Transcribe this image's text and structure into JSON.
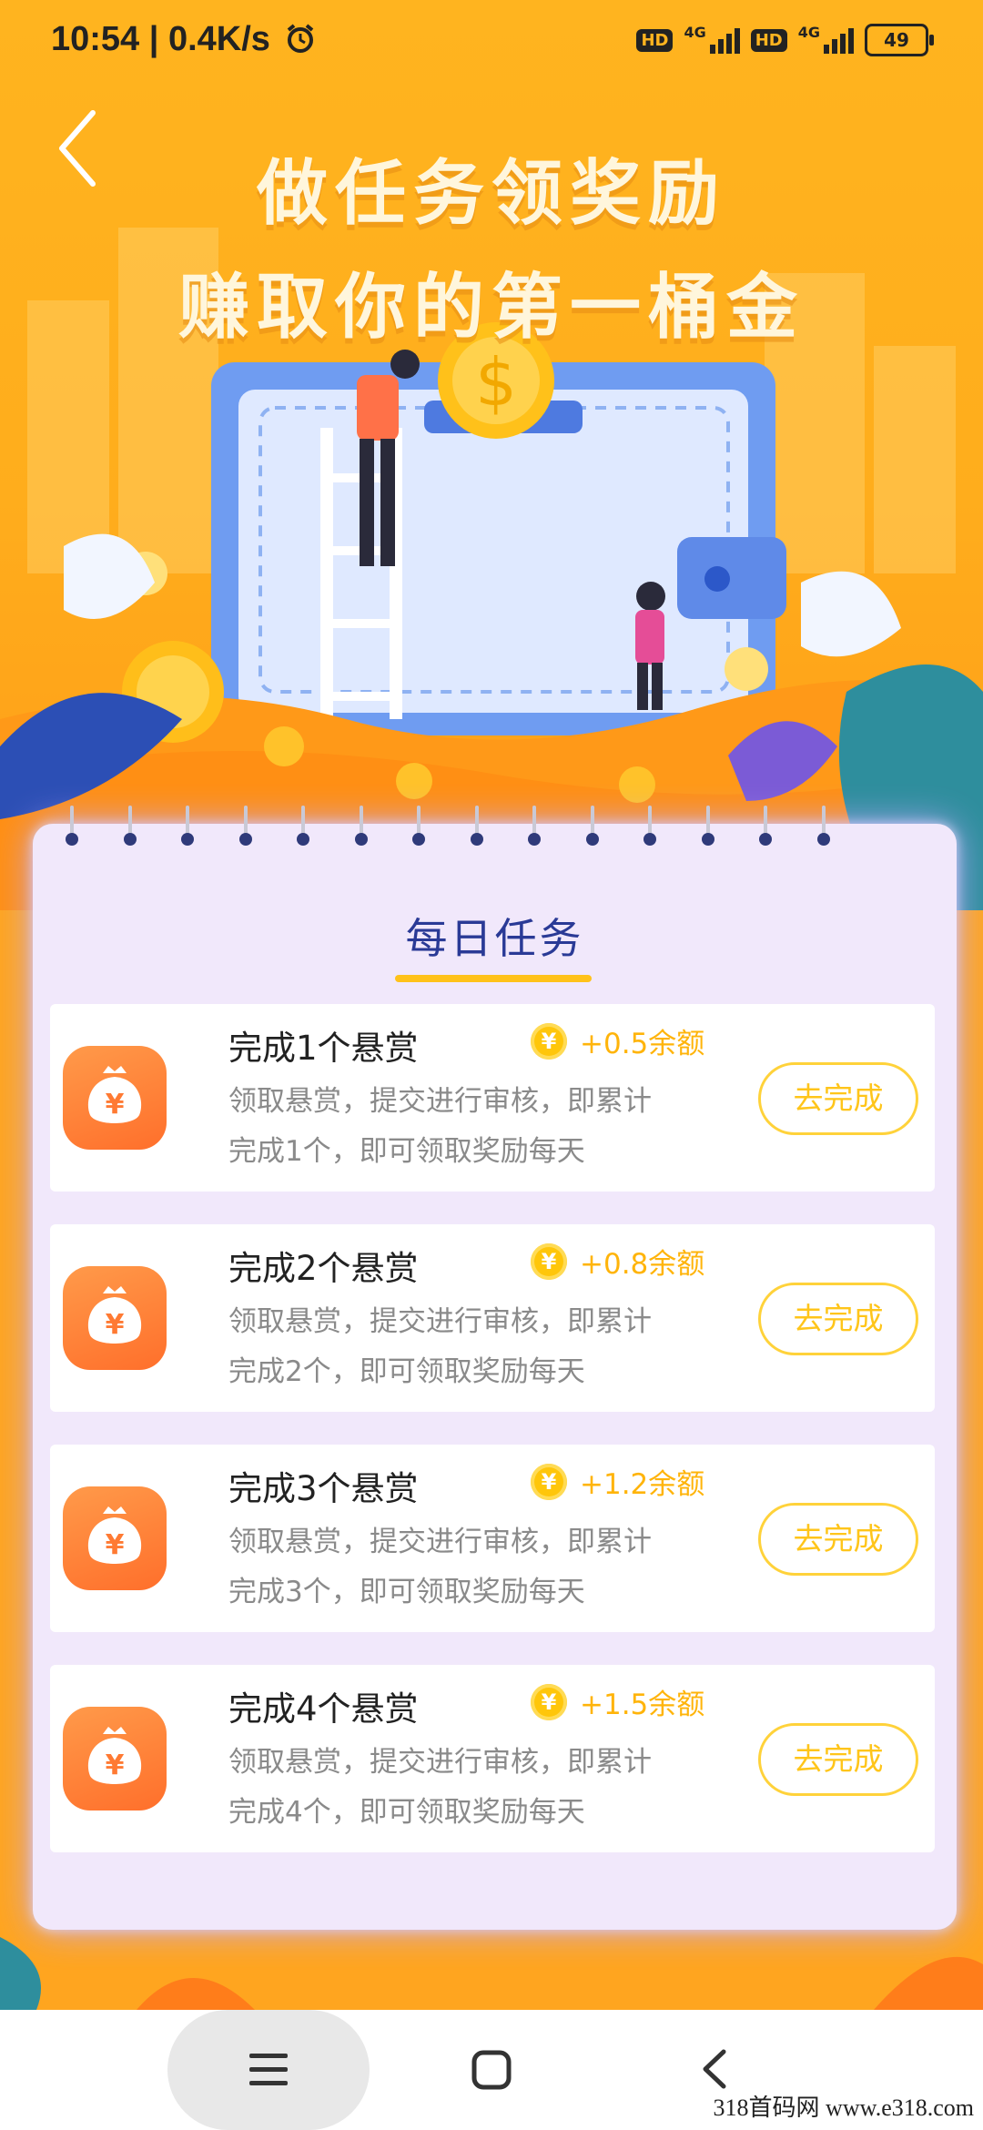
{
  "status_bar": {
    "time": "10:54",
    "speed": "0.4K/s",
    "hd": "HD",
    "network": "4G",
    "battery": "49"
  },
  "header": {
    "title_line1": "做任务领奖励",
    "title_line2": "赚取你的第一桶金"
  },
  "daily_tasks": {
    "title": "每日任务",
    "coin_symbol": "¥",
    "items": [
      {
        "title": "完成1个悬赏",
        "reward": "+0.5余额",
        "desc_line1": "领取悬赏，提交进行审核，即累计",
        "desc_line2": "完成1个，即可领取奖励每天",
        "button": "去完成"
      },
      {
        "title": "完成2个悬赏",
        "reward": "+0.8余额",
        "desc_line1": "领取悬赏，提交进行审核，即累计",
        "desc_line2": "完成2个，即可领取奖励每天",
        "button": "去完成"
      },
      {
        "title": "完成3个悬赏",
        "reward": "+1.2余额",
        "desc_line1": "领取悬赏，提交进行审核，即累计",
        "desc_line2": "完成3个，即可领取奖励每天",
        "button": "去完成"
      },
      {
        "title": "完成4个悬赏",
        "reward": "+1.5余额",
        "desc_line1": "领取悬赏，提交进行审核，即累计",
        "desc_line2": "完成4个，即可领取奖励每天",
        "button": "去完成"
      }
    ]
  },
  "watermark": "318首码网  www.e318.com",
  "colors": {
    "background": "#ffa51f",
    "card": "#f1e8fb",
    "title": "#2a3a96",
    "reward": "#ffb40a",
    "button_border": "#ffd23a",
    "task_icon": "#ff7a33"
  },
  "icons": [
    "back-arrow-icon",
    "alarm-clock-icon",
    "money-bag-icon",
    "coin-icon",
    "menu-icon",
    "home-icon",
    "back-icon"
  ]
}
